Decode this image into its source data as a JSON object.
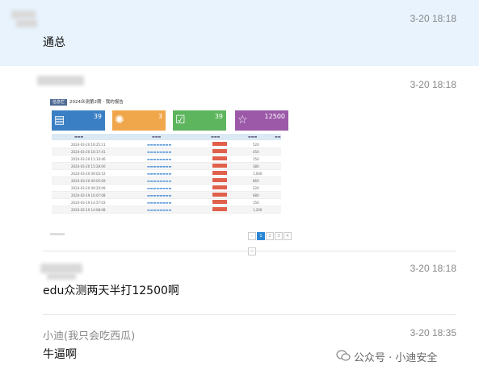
{
  "messages": [
    {
      "time": "3-20 18:18",
      "text": "通总"
    },
    {
      "time": "3-20 18:18"
    },
    {
      "time": "3-20 18:18",
      "text": "edu众测两天半打12500啊"
    },
    {
      "time": "3-20 18:35",
      "sender": "小迪(我只会吃西瓜)",
      "text": "牛逼啊"
    }
  ],
  "screenshot": {
    "tag": "信息栏",
    "title": "2024众测第2期 · 我的报告",
    "cards": [
      {
        "value": "39",
        "color": "#3a7fc4",
        "icon": "document-icon"
      },
      {
        "value": "3",
        "color": "#f0a74b",
        "icon": "loading-icon"
      },
      {
        "value": "39",
        "color": "#5db55d",
        "icon": "check-icon"
      },
      {
        "value": "12500",
        "color": "#9b59a8",
        "icon": "star-icon"
      }
    ],
    "rows": [
      {
        "date": "2024-03-20 16:25:11",
        "score": "520"
      },
      {
        "date": "2024-03-20 16:17:41",
        "score": "450"
      },
      {
        "date": "2024-03-20 11:10:46",
        "score": "150"
      },
      {
        "date": "2024-03-20 15:28:00",
        "score": "380"
      },
      {
        "date": "2024-03-20 09:03:52",
        "score": "1,000"
      },
      {
        "date": "2024-03-20 09:05:09",
        "score": "860"
      },
      {
        "date": "2024-03-20 09:20:09",
        "score": "220"
      },
      {
        "date": "2024-03-19 16:07:08",
        "score": "680"
      },
      {
        "date": "2024-03-19 14:57:03",
        "score": "150"
      },
      {
        "date": "2024-03-19 14:08:08",
        "score": "1,200"
      }
    ],
    "pages": [
      "‹",
      "1",
      "2",
      "3",
      "4",
      "»"
    ]
  },
  "watermark": "公众号 · 小迪安全"
}
